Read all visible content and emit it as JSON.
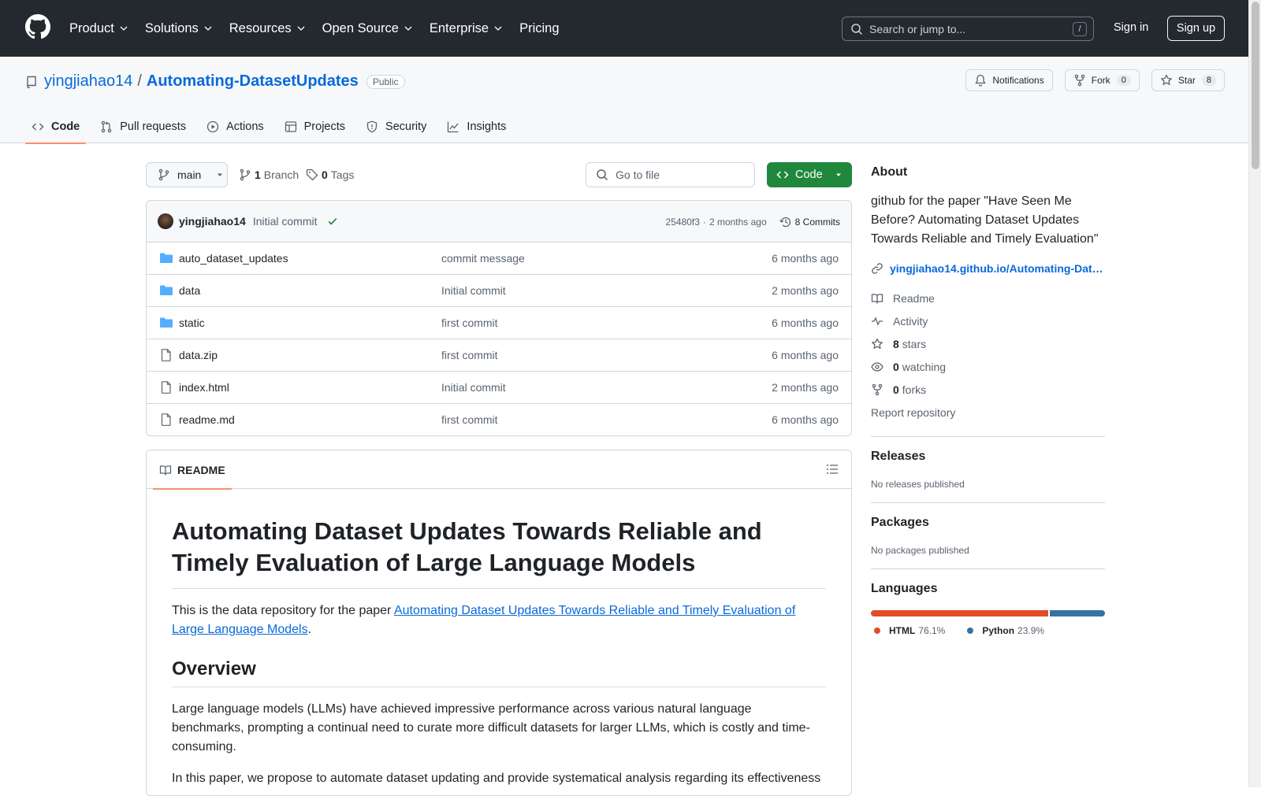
{
  "header": {
    "nav": [
      {
        "label": "Product",
        "dropdown": true
      },
      {
        "label": "Solutions",
        "dropdown": true
      },
      {
        "label": "Resources",
        "dropdown": true
      },
      {
        "label": "Open Source",
        "dropdown": true
      },
      {
        "label": "Enterprise",
        "dropdown": true
      },
      {
        "label": "Pricing",
        "dropdown": false
      }
    ],
    "search_placeholder": "Search or jump to...",
    "search_shortcut": "/",
    "sign_in": "Sign in",
    "sign_up": "Sign up"
  },
  "repo": {
    "owner": "yingjiahao14",
    "separator": "/",
    "name": "Automating-DatasetUpdates",
    "visibility": "Public",
    "actions": {
      "notifications": "Notifications",
      "fork_label": "Fork",
      "fork_count": "0",
      "star_label": "Star",
      "star_count": "8"
    },
    "tabs": [
      {
        "label": "Code",
        "icon": "code-icon",
        "active": true
      },
      {
        "label": "Pull requests",
        "icon": "pull-request-icon"
      },
      {
        "label": "Actions",
        "icon": "play-icon"
      },
      {
        "label": "Projects",
        "icon": "table-icon"
      },
      {
        "label": "Security",
        "icon": "shield-icon"
      },
      {
        "label": "Insights",
        "icon": "graph-icon"
      }
    ]
  },
  "toolbar": {
    "branch": "main",
    "branch_count": "1",
    "branch_label": "Branch",
    "tag_count": "0",
    "tag_label": "Tags",
    "goto_placeholder": "Go to file",
    "code_button": "Code"
  },
  "latest_commit": {
    "author": "yingjiahao14",
    "message": "Initial commit",
    "hash": "25480f3",
    "separator": "·",
    "time": "2 months ago",
    "commits_label": "8 Commits"
  },
  "files": [
    {
      "type": "dir",
      "name": "auto_dataset_updates",
      "message": "commit message",
      "date": "6 months ago"
    },
    {
      "type": "dir",
      "name": "data",
      "message": "Initial commit",
      "date": "2 months ago"
    },
    {
      "type": "dir",
      "name": "static",
      "message": "first commit",
      "date": "6 months ago"
    },
    {
      "type": "file",
      "name": "data.zip",
      "message": "first commit",
      "date": "6 months ago"
    },
    {
      "type": "file",
      "name": "index.html",
      "message": "Initial commit",
      "date": "2 months ago"
    },
    {
      "type": "file",
      "name": "readme.md",
      "message": "first commit",
      "date": "6 months ago"
    }
  ],
  "readme": {
    "tab_label": "README",
    "title": "Automating Dataset Updates Towards Reliable and Timely Evaluation of Large Language Models",
    "intro_prefix": "This is the data repository for the paper ",
    "intro_link": "Automating Dataset Updates Towards Reliable and Timely Evaluation of Large Language Models",
    "intro_suffix": ".",
    "overview_heading": "Overview",
    "overview_p1": "Large language models (LLMs) have achieved impressive performance across various natural language benchmarks, prompting a continual need to curate more difficult datasets for larger LLMs, which is costly and time-consuming.",
    "overview_p2": "In this paper, we propose to automate dataset updating and provide systematical analysis regarding its effectiveness"
  },
  "sidebar": {
    "about_heading": "About",
    "about_description": "github for the paper \"Have Seen Me Before? Automating Dataset Updates Towards Reliable and Timely Evaluation\"",
    "homepage": "yingjiahao14.github.io/Automating-Dat…",
    "readme": "Readme",
    "activity": "Activity",
    "stars_count": "8",
    "stars_label": "stars",
    "watching_count": "0",
    "watching_label": "watching",
    "forks_count": "0",
    "forks_label": "forks",
    "report": "Report repository",
    "releases_heading": "Releases",
    "releases_text": "No releases published",
    "packages_heading": "Packages",
    "packages_text": "No packages published",
    "languages_heading": "Languages",
    "languages": [
      {
        "name": "HTML",
        "percent": "76.1%",
        "value": 76.1,
        "color": "#e34c26"
      },
      {
        "name": "Python",
        "percent": "23.9%",
        "value": 23.9,
        "color": "#3572A5"
      }
    ]
  }
}
